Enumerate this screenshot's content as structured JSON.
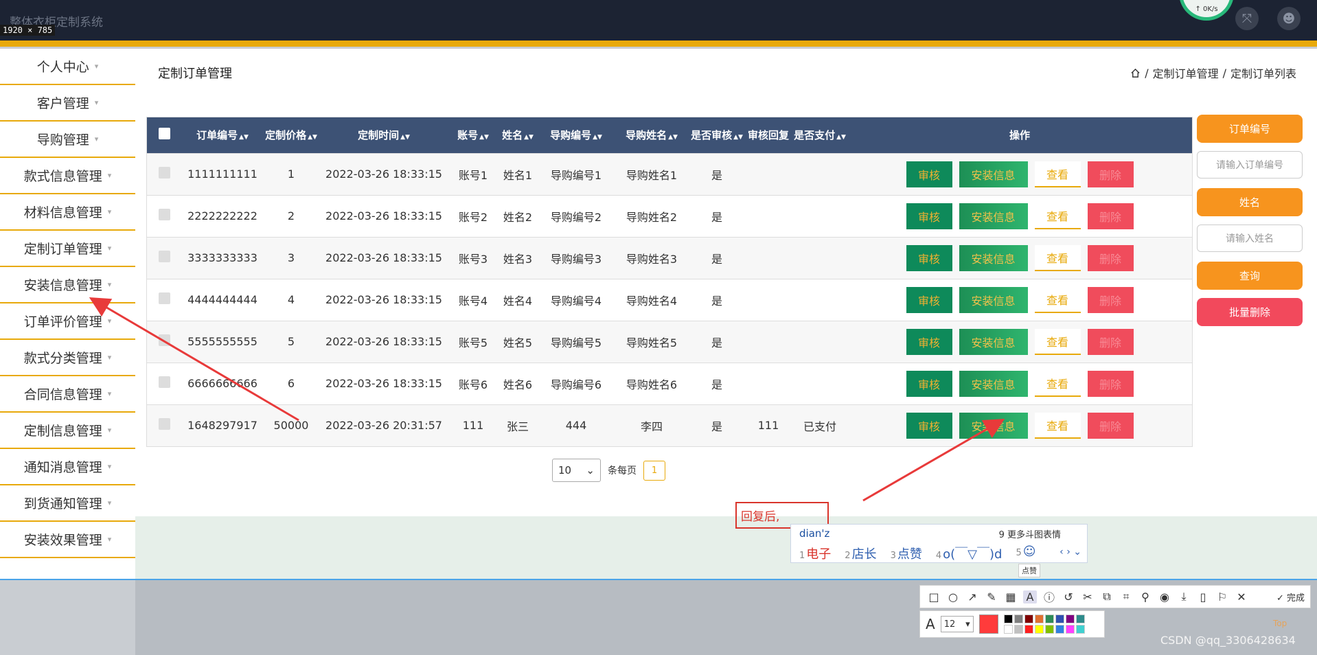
{
  "app": {
    "title": "整体衣柜定制系统",
    "size_label": "1920 × 785"
  },
  "netspeed": {
    "text": "↑ 0K/s"
  },
  "sidebar": {
    "items": [
      {
        "label": "个人中心"
      },
      {
        "label": "客户管理"
      },
      {
        "label": "导购管理"
      },
      {
        "label": "款式信息管理"
      },
      {
        "label": "材料信息管理"
      },
      {
        "label": "定制订单管理"
      },
      {
        "label": "安装信息管理"
      },
      {
        "label": "订单评价管理"
      },
      {
        "label": "款式分类管理"
      },
      {
        "label": "合同信息管理"
      },
      {
        "label": "定制信息管理"
      },
      {
        "label": "通知消息管理"
      },
      {
        "label": "到货通知管理"
      },
      {
        "label": "安装效果管理"
      }
    ]
  },
  "page": {
    "title": "定制订单管理"
  },
  "breadcrumb": {
    "level1": "定制订单管理",
    "sep": "/",
    "level2": "定制订单列表"
  },
  "table": {
    "headers": [
      "订单编号",
      "定制价格",
      "定制时间",
      "账号",
      "姓名",
      "导购编号",
      "导购姓名",
      "是否审核",
      "审核回复",
      "是否支付",
      "操作"
    ],
    "rows": [
      [
        "1111111111",
        "1",
        "2022-03-26 18:33:15",
        "账号1",
        "姓名1",
        "导购编号1",
        "导购姓名1",
        "是",
        "",
        ""
      ],
      [
        "2222222222",
        "2",
        "2022-03-26 18:33:15",
        "账号2",
        "姓名2",
        "导购编号2",
        "导购姓名2",
        "是",
        "",
        ""
      ],
      [
        "3333333333",
        "3",
        "2022-03-26 18:33:15",
        "账号3",
        "姓名3",
        "导购编号3",
        "导购姓名3",
        "是",
        "",
        ""
      ],
      [
        "4444444444",
        "4",
        "2022-03-26 18:33:15",
        "账号4",
        "姓名4",
        "导购编号4",
        "导购姓名4",
        "是",
        "",
        ""
      ],
      [
        "5555555555",
        "5",
        "2022-03-26 18:33:15",
        "账号5",
        "姓名5",
        "导购编号5",
        "导购姓名5",
        "是",
        "",
        ""
      ],
      [
        "6666666666",
        "6",
        "2022-03-26 18:33:15",
        "账号6",
        "姓名6",
        "导购编号6",
        "导购姓名6",
        "是",
        "",
        ""
      ],
      [
        "1648297917",
        "50000",
        "2022-03-26 20:31:57",
        "111",
        "张三",
        "444",
        "李四",
        "是",
        "111",
        "已支付"
      ]
    ],
    "actions": {
      "audit": "审核",
      "install": "安装信息",
      "view": "查看",
      "delete": "删除"
    }
  },
  "pagination": {
    "page_size": "10",
    "per_page_label": "条每页",
    "current_page": "1"
  },
  "search": {
    "order_no_label": "订单编号",
    "order_no_placeholder": "请输入订单编号",
    "name_label": "姓名",
    "name_placeholder": "请输入姓名",
    "query_label": "查询",
    "batch_delete_label": "批量删除"
  },
  "annotation": {
    "text": "回复后,"
  },
  "ime": {
    "input": "dian'z",
    "more": "9 更多斗图表情",
    "candidates": [
      {
        "idx": "1",
        "text": "电子"
      },
      {
        "idx": "2",
        "text": "店长"
      },
      {
        "idx": "3",
        "text": "点赞"
      },
      {
        "idx": "4",
        "text": "o(￣▽￣)d"
      },
      {
        "idx": "5",
        "text": "☺"
      }
    ],
    "tooltip": "点赞"
  },
  "snip": {
    "done_label": "完成",
    "font_size": "12",
    "color": "#ff3b3b",
    "palette": [
      "#000000",
      "#808080",
      "#800000",
      "#e07030",
      "#2e8b57",
      "#3050b0",
      "#800080",
      "#2e8b8b",
      "#ffffff",
      "#c0c0c0",
      "#ff2020",
      "#ffff00",
      "#80c000",
      "#3080e0",
      "#ff40ff",
      "#40d0d0"
    ]
  },
  "colors": {
    "accent": "#e8a90a",
    "header": "#3d5275",
    "green": "#0e8a5a",
    "red": "#f04c5c",
    "orange": "#f7941e"
  },
  "watermark": {
    "text": "CSDN @qq_3306428634"
  },
  "top_button": {
    "label": "Top"
  }
}
